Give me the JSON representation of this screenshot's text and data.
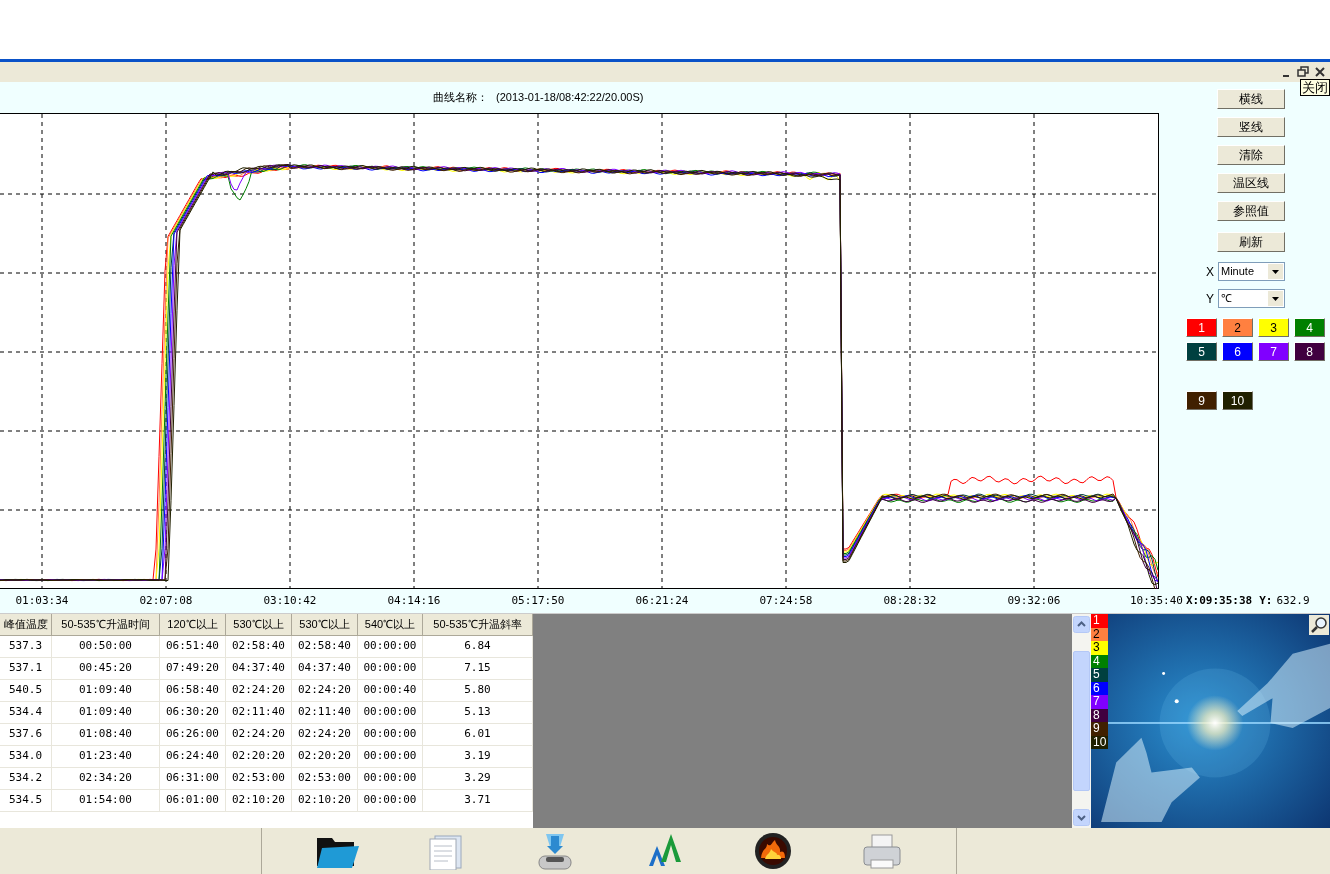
{
  "window": {
    "close_tooltip": "关闭"
  },
  "curve_name": {
    "label": "曲线名称：",
    "value": "(2013-01-18/08:42:22/20.00S)"
  },
  "buttons": [
    "横线",
    "竖线",
    "清除",
    "温区线",
    "参照值",
    "刷新"
  ],
  "axis_selects": [
    {
      "label": "X",
      "value": "Minute"
    },
    {
      "label": "Y",
      "value": "℃"
    }
  ],
  "channels": [
    {
      "label": "1",
      "color": "#ff0000"
    },
    {
      "label": "2",
      "color": "#ff8040"
    },
    {
      "label": "3",
      "color": "#ffff00"
    },
    {
      "label": "4",
      "color": "#008000"
    },
    {
      "label": "5",
      "color": "#004040"
    },
    {
      "label": "6",
      "color": "#0000ff"
    },
    {
      "label": "7",
      "color": "#8000ff"
    },
    {
      "label": "8",
      "color": "#400040"
    },
    {
      "label": "9",
      "color": "#402000"
    },
    {
      "label": "10",
      "color": "#202000"
    }
  ],
  "x_ticks": [
    "01:03:34",
    "02:07:08",
    "03:10:42",
    "04:14:16",
    "05:17:50",
    "06:21:24",
    "07:24:58",
    "08:28:32",
    "09:32:06",
    "10:35:40"
  ],
  "readout": {
    "x_label": "X:",
    "x_value": "09:35:38",
    "y_label": "Y:",
    "y_value": "632.9"
  },
  "table": {
    "columns": [
      "峰值温度",
      "50-535℃升温时间",
      "120℃以上",
      "530℃以上",
      "530℃以上",
      "540℃以上",
      "50-535℃升温斜率"
    ],
    "rows": [
      [
        "537.3",
        "00:50:00",
        "06:51:40",
        "02:58:40",
        "02:58:40",
        "00:00:00",
        "6.84"
      ],
      [
        "537.1",
        "00:45:20",
        "07:49:20",
        "04:37:40",
        "04:37:40",
        "00:00:00",
        "7.15"
      ],
      [
        "540.5",
        "01:09:40",
        "06:58:40",
        "02:24:20",
        "02:24:20",
        "00:00:40",
        "5.80"
      ],
      [
        "534.4",
        "01:09:40",
        "06:30:20",
        "02:11:40",
        "02:11:40",
        "00:00:00",
        "5.13"
      ],
      [
        "537.6",
        "01:08:40",
        "06:26:00",
        "02:24:20",
        "02:24:20",
        "00:00:00",
        "6.01"
      ],
      [
        "534.0",
        "01:23:40",
        "06:24:40",
        "02:20:20",
        "02:20:20",
        "00:00:00",
        "3.19"
      ],
      [
        "534.2",
        "02:34:20",
        "06:31:00",
        "02:53:00",
        "02:53:00",
        "00:00:00",
        "3.29"
      ],
      [
        "534.5",
        "01:54:00",
        "06:01:00",
        "02:10:20",
        "02:10:20",
        "00:00:00",
        "3.71"
      ]
    ]
  },
  "legend": [
    {
      "label": "1",
      "color": "#ff0000"
    },
    {
      "label": "2",
      "color": "#ff8040"
    },
    {
      "label": "3",
      "color": "#ffff00"
    },
    {
      "label": "4",
      "color": "#008000"
    },
    {
      "label": "5",
      "color": "#004040"
    },
    {
      "label": "6",
      "color": "#0000ff"
    },
    {
      "label": "7",
      "color": "#8000ff"
    },
    {
      "label": "8",
      "color": "#400040"
    },
    {
      "label": "9",
      "color": "#402000"
    },
    {
      "label": "10",
      "color": "#202000"
    }
  ]
}
